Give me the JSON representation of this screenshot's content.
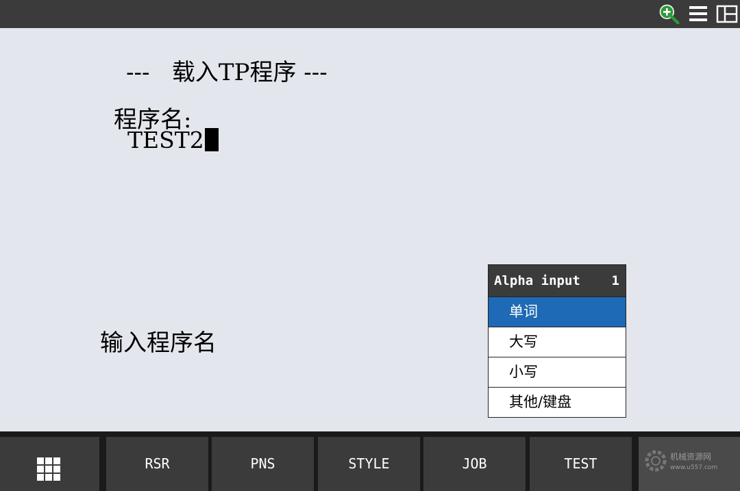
{
  "header": {
    "icons": [
      "zoom-in-icon",
      "menu-icon",
      "layout-split-icon"
    ]
  },
  "screen": {
    "title": "---   载入TP程序 ---",
    "field_label": "程序名:",
    "field_value": "TEST2",
    "prompt": "输入程序名"
  },
  "popup": {
    "title": "Alpha input",
    "number": "1",
    "items": [
      {
        "label": "单词",
        "selected": true
      },
      {
        "label": "大写",
        "selected": false
      },
      {
        "label": "小写",
        "selected": false
      },
      {
        "label": "其他/键盘",
        "selected": false
      }
    ]
  },
  "function_keys": {
    "menu_icon": "grid-menu-icon",
    "keys": [
      "RSR",
      "PNS",
      "STYLE",
      "JOB",
      "TEST"
    ]
  },
  "watermark": {
    "line1": "机械资源网",
    "line2": "www.u557.com"
  },
  "colors": {
    "selected_item": "#1e6ab6",
    "zoom_icon": "#2e9a3a",
    "background": "#e3e6ec",
    "bar": "#3b3b3b"
  }
}
